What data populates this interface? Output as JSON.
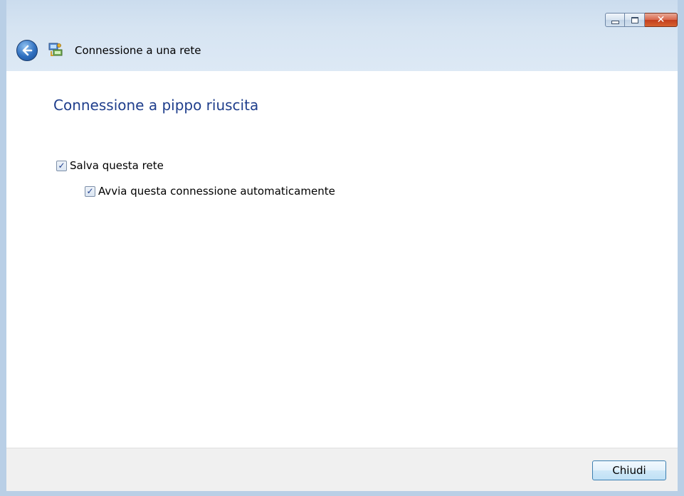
{
  "window": {
    "title": "Connessione a una rete",
    "controls": {
      "minimize": "minimize",
      "maximize": "maximize",
      "close": "close"
    }
  },
  "content": {
    "heading": "Connessione a pippo riuscita",
    "checkboxes": [
      {
        "label": "Salva questa rete",
        "checked": true
      },
      {
        "label": "Avvia questa connessione automaticamente",
        "checked": true
      }
    ]
  },
  "footer": {
    "close_button": "Chiudi"
  },
  "icons": {
    "back": "back-arrow-icon",
    "network": "network-connection-icon"
  }
}
